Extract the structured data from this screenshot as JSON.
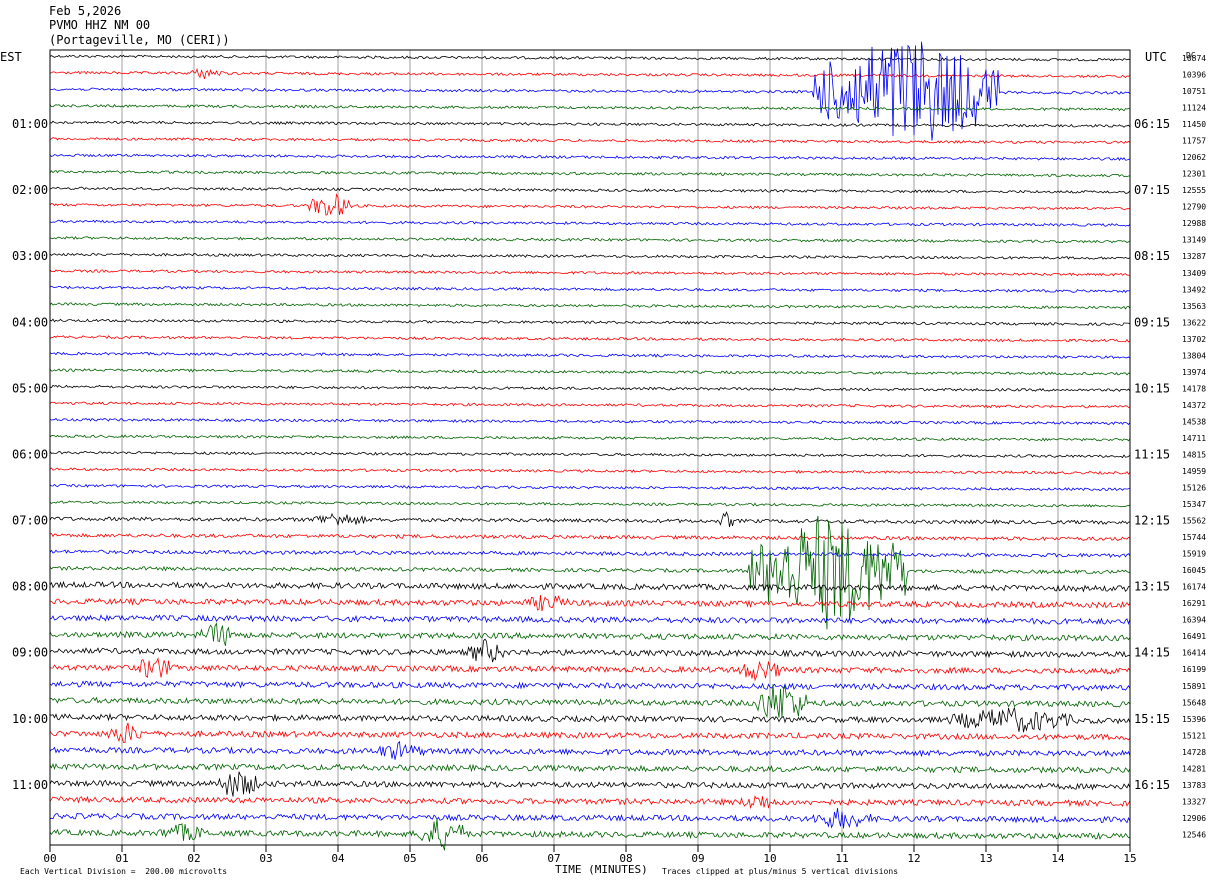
{
  "header": {
    "date": "Feb 5,2026",
    "station": "PVMO HHZ NM 00",
    "location": "(Portageville, MO (CERI))"
  },
  "left_zone": "EST",
  "right_zone": "UTC",
  "dc_label": "DC",
  "footer": {
    "scale_note": "Each Vertical Division =  200.00 microvolts",
    "xlabel": "TIME (MINUTES)",
    "clip_note": "Traces clipped at plus/minus 5 vertical divisions"
  },
  "chart_data": {
    "type": "line",
    "title": "PVMO HHZ NM 00",
    "xlabel": "TIME (MINUTES)",
    "xlim": [
      0,
      15
    ],
    "x_ticks": [
      "00",
      "01",
      "02",
      "03",
      "04",
      "05",
      "06",
      "07",
      "08",
      "09",
      "10",
      "11",
      "12",
      "13",
      "14",
      "15"
    ],
    "trace_count": 48,
    "trace_colors": [
      "#000000",
      "#ff0000",
      "#0000ff",
      "#006400"
    ],
    "left_time_labels": [
      {
        "row": 4,
        "label": "01:00"
      },
      {
        "row": 8,
        "label": "02:00"
      },
      {
        "row": 12,
        "label": "03:00"
      },
      {
        "row": 16,
        "label": "04:00"
      },
      {
        "row": 20,
        "label": "05:00"
      },
      {
        "row": 24,
        "label": "06:00"
      },
      {
        "row": 28,
        "label": "07:00"
      },
      {
        "row": 32,
        "label": "08:00"
      },
      {
        "row": 36,
        "label": "09:00"
      },
      {
        "row": 40,
        "label": "10:00"
      },
      {
        "row": 44,
        "label": "11:00"
      }
    ],
    "right_time_labels": [
      {
        "row": 4,
        "label": "06:15"
      },
      {
        "row": 8,
        "label": "07:15"
      },
      {
        "row": 12,
        "label": "08:15"
      },
      {
        "row": 16,
        "label": "09:15"
      },
      {
        "row": 20,
        "label": "10:15"
      },
      {
        "row": 24,
        "label": "11:15"
      },
      {
        "row": 28,
        "label": "12:15"
      },
      {
        "row": 32,
        "label": "13:15"
      },
      {
        "row": 36,
        "label": "14:15"
      },
      {
        "row": 40,
        "label": "15:15"
      },
      {
        "row": 44,
        "label": "16:15"
      }
    ],
    "dc_offsets": [
      "10874",
      "10396",
      "10751",
      "11124",
      "11450",
      "11757",
      "12062",
      "12301",
      "12555",
      "12790",
      "12988",
      "13149",
      "13287",
      "13409",
      "13492",
      "13563",
      "13622",
      "13702",
      "13804",
      "13974",
      "14178",
      "14372",
      "14538",
      "14711",
      "14815",
      "14959",
      "15126",
      "15347",
      "15562",
      "15744",
      "15919",
      "16045",
      "16174",
      "16291",
      "16394",
      "16491",
      "16414",
      "16199",
      "15891",
      "15648",
      "15396",
      "15121",
      "14728",
      "14281",
      "13783",
      "13327",
      "12906",
      "12546"
    ],
    "events": [
      {
        "row": 1,
        "start_min": 1.9,
        "end_min": 2.4,
        "amp": 6
      },
      {
        "row": 2,
        "start_min": 10.6,
        "end_min": 13.2,
        "amp": 60
      },
      {
        "row": 9,
        "start_min": 3.6,
        "end_min": 4.2,
        "amp": 14
      },
      {
        "row": 28,
        "start_min": 3.6,
        "end_min": 4.4,
        "amp": 8
      },
      {
        "row": 28,
        "start_min": 9.3,
        "end_min": 9.5,
        "amp": 10
      },
      {
        "row": 31,
        "start_min": 9.7,
        "end_min": 11.9,
        "amp": 60
      },
      {
        "row": 33,
        "start_min": 6.6,
        "end_min": 7.2,
        "amp": 10
      },
      {
        "row": 35,
        "start_min": 2.1,
        "end_min": 2.6,
        "amp": 14
      },
      {
        "row": 36,
        "start_min": 5.8,
        "end_min": 6.3,
        "amp": 14
      },
      {
        "row": 37,
        "start_min": 1.2,
        "end_min": 1.7,
        "amp": 14
      },
      {
        "row": 37,
        "start_min": 9.5,
        "end_min": 10.2,
        "amp": 12
      },
      {
        "row": 39,
        "start_min": 9.8,
        "end_min": 10.5,
        "amp": 24
      },
      {
        "row": 40,
        "start_min": 12.5,
        "end_min": 14.2,
        "amp": 14
      },
      {
        "row": 41,
        "start_min": 0.8,
        "end_min": 1.3,
        "amp": 12
      },
      {
        "row": 42,
        "start_min": 4.5,
        "end_min": 5.2,
        "amp": 10
      },
      {
        "row": 44,
        "start_min": 2.3,
        "end_min": 2.9,
        "amp": 16
      },
      {
        "row": 45,
        "start_min": 9.6,
        "end_min": 10.1,
        "amp": 10
      },
      {
        "row": 46,
        "start_min": 10.6,
        "end_min": 11.4,
        "amp": 12
      },
      {
        "row": 47,
        "start_min": 5.1,
        "end_min": 5.8,
        "amp": 18
      },
      {
        "row": 47,
        "start_min": 1.5,
        "end_min": 2.2,
        "amp": 10
      }
    ]
  }
}
